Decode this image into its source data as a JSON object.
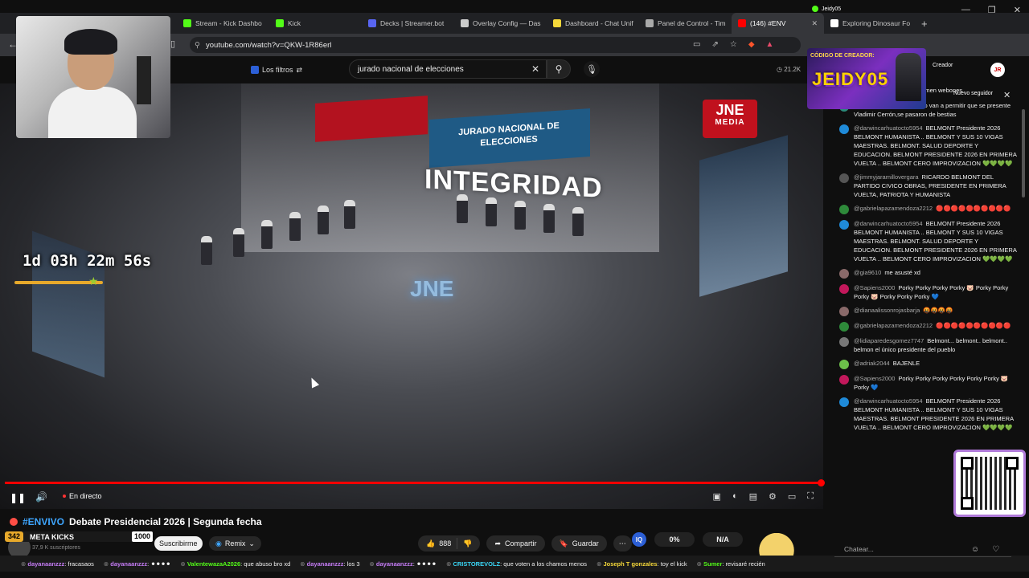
{
  "browser": {
    "tabs": [
      {
        "label": "Stream - Kick Dashbo",
        "color": "#53fc18",
        "active": false
      },
      {
        "label": "Kick",
        "color": "#53fc18",
        "active": false
      },
      {
        "label": "Decks | Streamer.bot",
        "color": "#5865f2",
        "active": false
      },
      {
        "label": "Overlay Config — Das",
        "color": "#cccccc",
        "active": false
      },
      {
        "label": "Dashboard - Chat Unif",
        "color": "#f5d83a",
        "active": false
      },
      {
        "label": "Panel de Control - Tim",
        "color": "#aaaaaa",
        "active": false
      },
      {
        "label": "(146) #ENV",
        "color": "#ff0000",
        "active": true
      },
      {
        "label": "Exploring Dinosaur Fo",
        "color": "#ffffff",
        "active": false
      }
    ],
    "url": "youtube.com/watch?v=QKW-1R86erl"
  },
  "youtube": {
    "filters_label": "Los filtros",
    "search_query": "jurado nacional de elecciones",
    "viewers": "21.2K"
  },
  "video": {
    "banner_text": "JURADO NACIONAL DE ELECCIONES",
    "integridad": "INTEGRIDAD",
    "floor_logo": "JNE",
    "badge_top": "JNE",
    "badge_bottom": "MEDIA",
    "timer": "1d 03h 22m 56s",
    "live_label": "En directo"
  },
  "info": {
    "tag": "#ENVIVO",
    "title": "Debate Presidencial 2026 | Segunda fecha",
    "subs": "37,9 K suscriptores",
    "subscribe": "Suscribirme",
    "remix": "Remix",
    "likes": "888",
    "share": "Compartir",
    "save": "Guardar",
    "stat_iq": "IQ",
    "stat_1": "0%",
    "stat_2": "N/A"
  },
  "meta_kicks": {
    "count": "342",
    "label": "META KICKS",
    "goal": "1000"
  },
  "overlay": {
    "kick_user": "Jeidy05",
    "jeidy_code": "CÓDIGO DE CREADOR:",
    "jeidy_name": "JEIDY05",
    "chat_top": "Creador",
    "chat_top2": "Nuevo seguidor",
    "avatar_text": "JR"
  },
  "chat": {
    "messages": [
      {
        "user": "@silver07723",
        "text": "mucho volumen webones",
        "color": "#7a3030"
      },
      {
        "user": "@kharenlinares3956",
        "text": "como van a permitir que se presente Vladimir Cerrón,se pasaron de bestias",
        "color": "#2a8a7a"
      },
      {
        "user": "@darwincarhuatocto5954",
        "text": "BELMONT Presidente 2026 BELMONT HUMANISTA .. BELMONT Y SUS 10 VIGAS MAESTRAS. BELMONT. SALUD DEPORTE Y EDUCACION. BELMONT PRESIDENTE 2026 EN PRIMERA VUELTA .. BELMONT CERO IMPROVIZACION 💚💚💚💚",
        "color": "#1f8ad8"
      },
      {
        "user": "@jimmyjaramillovergara",
        "text": "RICARDO BELMONT DEL PARTIDO CIVICO OBRAS, PRESIDENTE EN PRIMERA VUELTA, PATRIOTA Y HUMANISTA",
        "color": "#555555"
      },
      {
        "user": "@gabrielapazamendoza2212",
        "text": "🔴🔴🔴🔴🔴🔴🔴🔴🔴🔴",
        "color": "#2e8a3a"
      },
      {
        "user": "@darwincarhuatocto5954",
        "text": "BELMONT Presidente 2026 BELMONT HUMANISTA .. BELMONT Y SUS 10 VIGAS MAESTRAS. BELMONT. SALUD DEPORTE Y EDUCACION. BELMONT PRESIDENTE 2026 EN PRIMERA VUELTA .. BELMONT CERO IMPROVIZACION 💚💚💚💚",
        "color": "#1f8ad8"
      },
      {
        "user": "@gia9610",
        "text": "me asusté xd",
        "color": "#8a6a6a"
      },
      {
        "user": "@Sapiens2000",
        "text": "Porky Porky Porky Porky 🐷 Porky Porky Porky 🐷 Porky Porky Porky 💙",
        "color": "#c2185b"
      },
      {
        "user": "@dianaalissonrojasbarja",
        "text": "🤬🤬🤬🤬",
        "color": "#8a6a6a"
      },
      {
        "user": "@gabrielapazamendoza2212",
        "text": "🔴🔴🔴🔴🔴🔴🔴🔴🔴🔴",
        "color": "#2e8a3a"
      },
      {
        "user": "@lidiaparedesgomez7747",
        "text": "Belmont... belmont.. belmont.. belmon el único presidente del pueblo",
        "color": "#777777"
      },
      {
        "user": "@adriak2044",
        "text": "BAJENLE",
        "color": "#6cc04a"
      },
      {
        "user": "@Sapiens2000",
        "text": "Porky Porky Porky Porky Porky Porky 🐷 Porky 💙",
        "color": "#c2185b"
      },
      {
        "user": "@darwincarhuatocto5954",
        "text": "BELMONT Presidente 2026 BELMONT HUMANISTA .. BELMONT Y SUS 10 VIGAS MAESTRAS. BELMONT PRESIDENTE 2026 EN PRIMERA VUELTA .. BELMONT CERO IMPROVIZACION 💚💚💚💚",
        "color": "#1f8ad8"
      }
    ],
    "input_placeholder": "Chatear..."
  },
  "ticker": [
    {
      "user": "dayanaanzzz",
      "text": ": fracasaos",
      "cls": ""
    },
    {
      "user": "dayanaanzzz",
      "text": ": ⚫⚫⚫⚫",
      "cls": ""
    },
    {
      "user": "ValentewazaA2026",
      "text": ": que abuso bro xd",
      "cls": "g"
    },
    {
      "user": "dayanaanzzz",
      "text": ": los 3",
      "cls": ""
    },
    {
      "user": "dayanaanzzz",
      "text": ": ⚫⚫⚫⚫",
      "cls": ""
    },
    {
      "user": "CRISTOREVOLZ",
      "text": ": que voten a los chamos menos",
      "cls": "c"
    },
    {
      "user": "Joseph T gonzales",
      "text": ": toy el kick",
      "cls": "y"
    },
    {
      "user": "Sumer",
      "text": ": revisaré recién",
      "cls": "g"
    }
  ]
}
